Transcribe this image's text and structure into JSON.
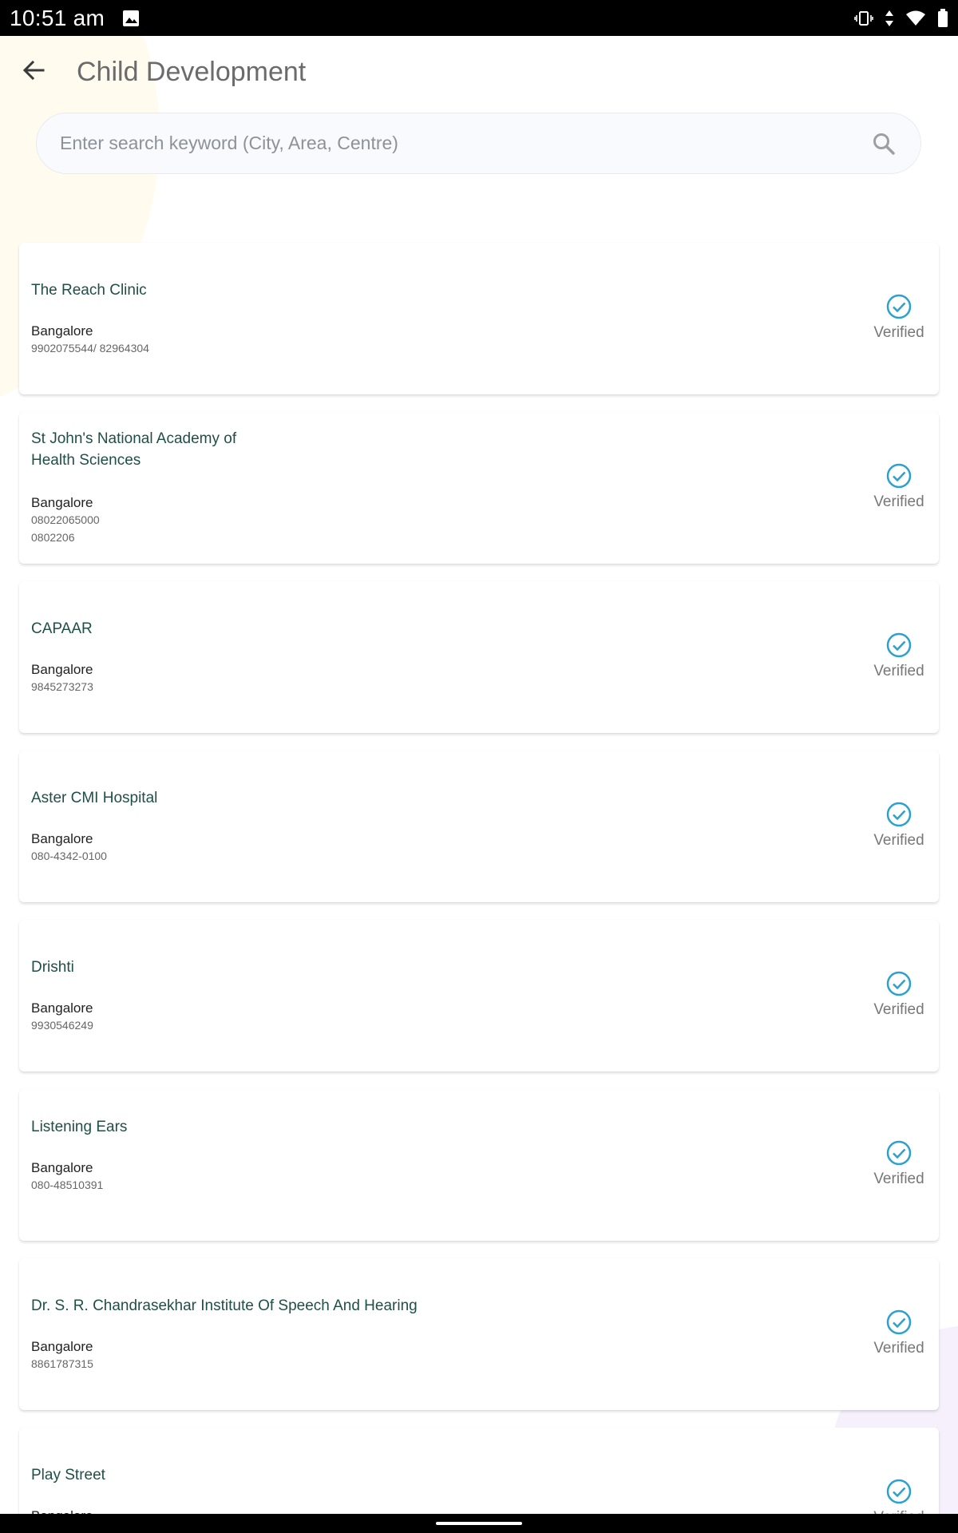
{
  "status_bar": {
    "time": "10:51 am",
    "icons": [
      "image-icon",
      "vibrate-icon",
      "data-arrows-icon",
      "wifi-icon",
      "battery-icon"
    ]
  },
  "app_bar": {
    "title": "Child Development",
    "back_icon": "arrow-left-icon"
  },
  "search": {
    "placeholder": "Enter search keyword (City, Area, Centre)",
    "value": "",
    "icon": "search-icon"
  },
  "colors": {
    "accent": "#2aa1d0",
    "name_text": "#1f4f47",
    "status_bar": "#000000"
  },
  "centres": [
    {
      "name": "The Reach Clinic",
      "city": "Bangalore",
      "phone": "9902075544/ 82964304",
      "phone2": "",
      "status": "Verified"
    },
    {
      "name": "St John's National Academy of Health Sciences",
      "city": "Bangalore",
      "phone": "08022065000",
      "phone2": "0802206",
      "status": "Verified"
    },
    {
      "name": "CAPAAR",
      "city": "Bangalore",
      "phone": "9845273273",
      "phone2": "",
      "status": "Verified"
    },
    {
      "name": "Aster CMI Hospital",
      "city": "Bangalore",
      "phone": "080-4342-0100",
      "phone2": "",
      "status": "Verified"
    },
    {
      "name": "Drishti",
      "city": "Bangalore",
      "phone": "9930546249",
      "phone2": "",
      "status": "Verified"
    },
    {
      "name": "Listening Ears",
      "city": "Bangalore",
      "phone": "080-48510391",
      "phone2": "",
      "status": "Verified"
    },
    {
      "name": "Dr. S. R. Chandrasekhar Institute Of Speech And Hearing",
      "city": "Bangalore",
      "phone": "8861787315",
      "phone2": "",
      "status": "Verified"
    },
    {
      "name": "Play Street",
      "city": "Bangalore",
      "phone": "",
      "phone2": "",
      "status": "Verified"
    }
  ]
}
